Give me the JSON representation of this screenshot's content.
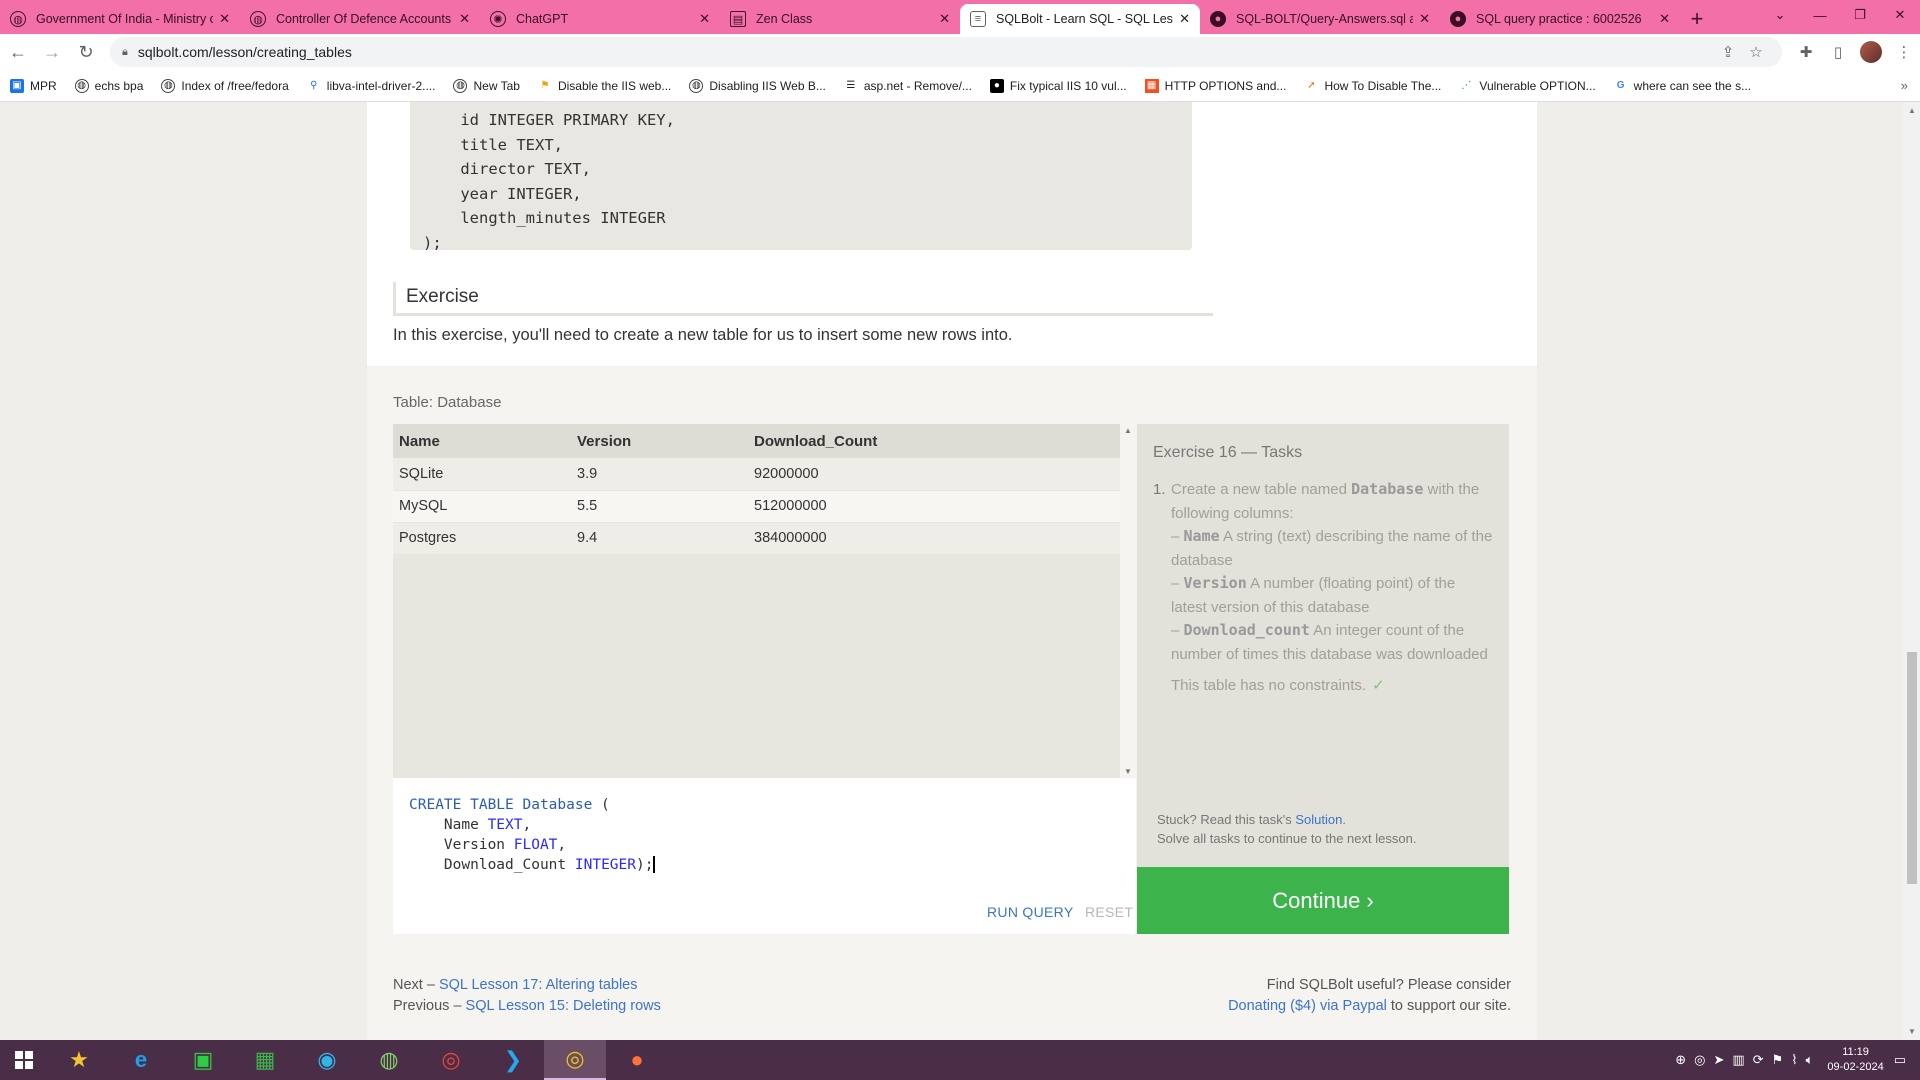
{
  "browser": {
    "tabs": [
      {
        "title": "Government Of India - Ministry o",
        "icon": "globe-icon",
        "active": false
      },
      {
        "title": "Controller Of Defence Accounts (",
        "icon": "globe-icon",
        "active": false
      },
      {
        "title": "ChatGPT",
        "icon": "chatgpt-icon",
        "active": false
      },
      {
        "title": "Zen Class",
        "icon": "zen-icon",
        "active": false
      },
      {
        "title": "SQLBolt - Learn SQL - SQL Lesso",
        "icon": "database-icon",
        "active": true
      },
      {
        "title": "SQL-BOLT/Query-Answers.sql at",
        "icon": "github-icon",
        "active": false
      },
      {
        "title": "SQL query practice : 6002526",
        "icon": "github-icon",
        "active": false
      }
    ],
    "url": "sqlbolt.com/lesson/creating_tables",
    "bookmarks": [
      {
        "label": "MPR",
        "icon": "mpr-icon"
      },
      {
        "label": "echs bpa",
        "icon": "globe-icon"
      },
      {
        "label": "Index of /free/fedora",
        "icon": "globe-icon"
      },
      {
        "label": "libva-intel-driver-2....",
        "icon": "search-icon"
      },
      {
        "label": "New Tab",
        "icon": "globe-icon"
      },
      {
        "label": "Disable the IIS web...",
        "icon": "bookmark-icon"
      },
      {
        "label": "Disabling IIS Web B...",
        "icon": "globe-icon"
      },
      {
        "label": "asp.net - Remove/...",
        "icon": "stack-icon"
      },
      {
        "label": "Fix typical IIS 10 vul...",
        "icon": "medium-icon"
      },
      {
        "label": "HTTP OPTIONS and...",
        "icon": "windows-icon"
      },
      {
        "label": "How To Disable The...",
        "icon": "rocket-icon"
      },
      {
        "label": "Vulnerable OPTION...",
        "icon": "dots-icon"
      },
      {
        "label": "where can see the s...",
        "icon": "google-icon"
      }
    ]
  },
  "lesson": {
    "code_lines": [
      "    id INTEGER PRIMARY KEY,",
      "    title TEXT,",
      "    director TEXT,",
      "    year INTEGER,",
      "    length_minutes INTEGER",
      ");"
    ],
    "exercise_heading": "Exercise",
    "exercise_text": "In this exercise, you'll need to create a new table for us to insert some new rows into."
  },
  "table": {
    "label": "Table: Database",
    "columns": [
      "Name",
      "Version",
      "Download_Count"
    ],
    "rows": [
      [
        "SQLite",
        "3.9",
        "92000000"
      ],
      [
        "MySQL",
        "5.5",
        "512000000"
      ],
      [
        "Postgres",
        "9.4",
        "384000000"
      ]
    ]
  },
  "editor": {
    "line1_kw": "CREATE TABLE Database",
    "line1_rest": " (",
    "line2_name": "    Name ",
    "line2_type": "TEXT",
    "line2_end": ",",
    "line3_name": "    Version ",
    "line3_type": "FLOAT",
    "line3_end": ",",
    "line4_name": "    Download_Count ",
    "line4_type": "INTEGER",
    "line4_end": ");",
    "run_label": "RUN QUERY",
    "reset_label": "RESET"
  },
  "tasks": {
    "title": "Exercise 16 — Tasks",
    "num": "1.",
    "intro_a": "Create a new table named ",
    "intro_code": "Database",
    "intro_b": " with the following columns:",
    "col1_code": "Name",
    "col1_text": " A string (text) describing the name of the database",
    "col2_code": "Version",
    "col2_text": " A number (floating point) of the latest version of this database",
    "col3_code": "Download_count",
    "col3_text": " An integer count of the number of times this database was downloaded",
    "constraints": "This table has no constraints.",
    "stuck_a": "Stuck? Read this task's ",
    "stuck_link": "Solution",
    "stuck_b": ".",
    "solve_all": "Solve all tasks to continue to the next lesson.",
    "continue_label": "Continue ›"
  },
  "footer": {
    "next_prefix": "Next – ",
    "next_link": "SQL Lesson 17: Altering tables",
    "prev_prefix": "Previous – ",
    "prev_link": "SQL Lesson 15: Deleting rows",
    "useful": "Find SQLBolt useful? Please consider",
    "donate_link": "Donating ($4) via Paypal",
    "donate_suffix": " to support our site."
  },
  "taskbar": {
    "time": "11:19",
    "date": "09-02-2024"
  }
}
